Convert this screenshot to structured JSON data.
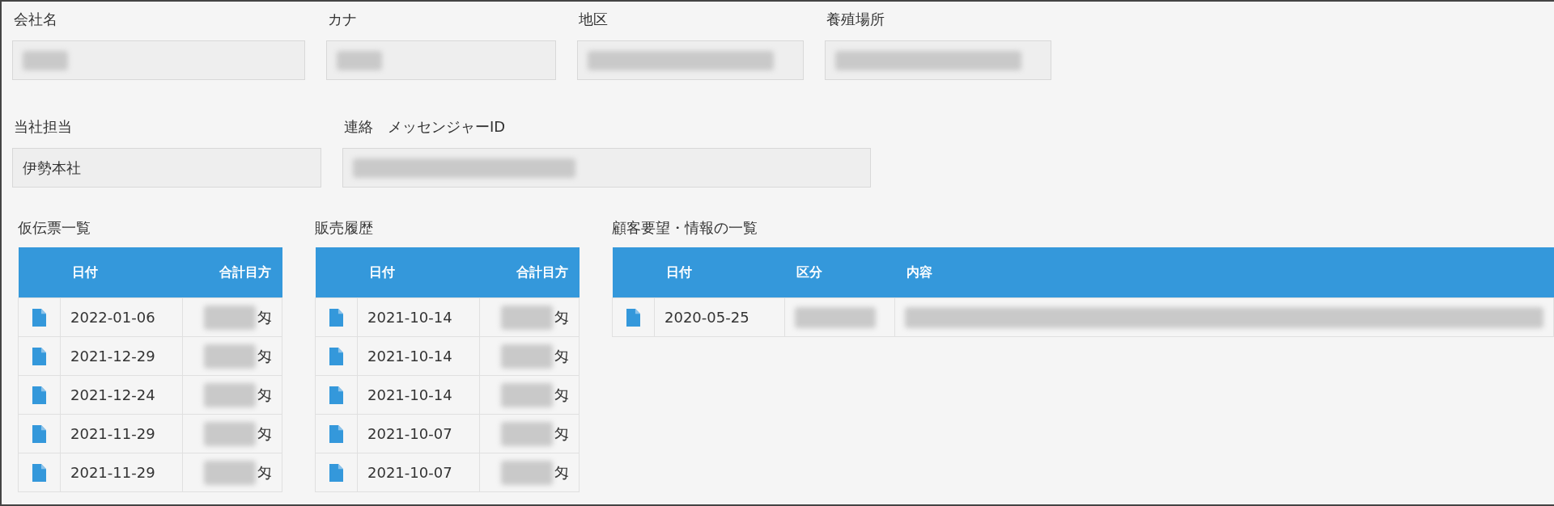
{
  "fields_row_1": [
    {
      "label": "会社名",
      "redacted": true
    },
    {
      "label": "カナ",
      "redacted": true
    },
    {
      "label": "地区",
      "redacted": true
    },
    {
      "label": "養殖場所",
      "redacted": true
    }
  ],
  "fields_row_2": [
    {
      "label": "当社担当",
      "value": "伊勢本社"
    },
    {
      "label": "連絡　メッセンジャーID",
      "redacted": true
    }
  ],
  "tables": [
    {
      "title": "仮伝票一覧",
      "kind": "amount",
      "columns": [
        "日付",
        "合計目方"
      ],
      "rows": [
        {
          "date": "2022-01-06",
          "amount_redacted": true,
          "unit": "匁"
        },
        {
          "date": "2021-12-29",
          "amount_redacted": true,
          "unit": "匁"
        },
        {
          "date": "2021-12-24",
          "amount_redacted": true,
          "unit": "匁"
        },
        {
          "date": "2021-11-29",
          "amount_redacted": true,
          "unit": "匁"
        },
        {
          "date": "2021-11-29",
          "amount_redacted": true,
          "unit": "匁"
        }
      ]
    },
    {
      "title": "販売履歴",
      "kind": "amount",
      "columns": [
        "日付",
        "合計目方"
      ],
      "rows": [
        {
          "date": "2021-10-14",
          "amount_redacted": true,
          "unit": "匁"
        },
        {
          "date": "2021-10-14",
          "amount_redacted": true,
          "unit": "匁"
        },
        {
          "date": "2021-10-14",
          "amount_redacted": true,
          "unit": "匁"
        },
        {
          "date": "2021-10-07",
          "amount_redacted": true,
          "unit": "匁"
        },
        {
          "date": "2021-10-07",
          "amount_redacted": true,
          "unit": "匁"
        }
      ]
    },
    {
      "title": "顧客要望・情報の一覧",
      "kind": "request",
      "columns": [
        "日付",
        "区分",
        "内容"
      ],
      "rows": [
        {
          "date": "2020-05-25",
          "category_redacted": true,
          "content_redacted": true
        }
      ]
    }
  ]
}
